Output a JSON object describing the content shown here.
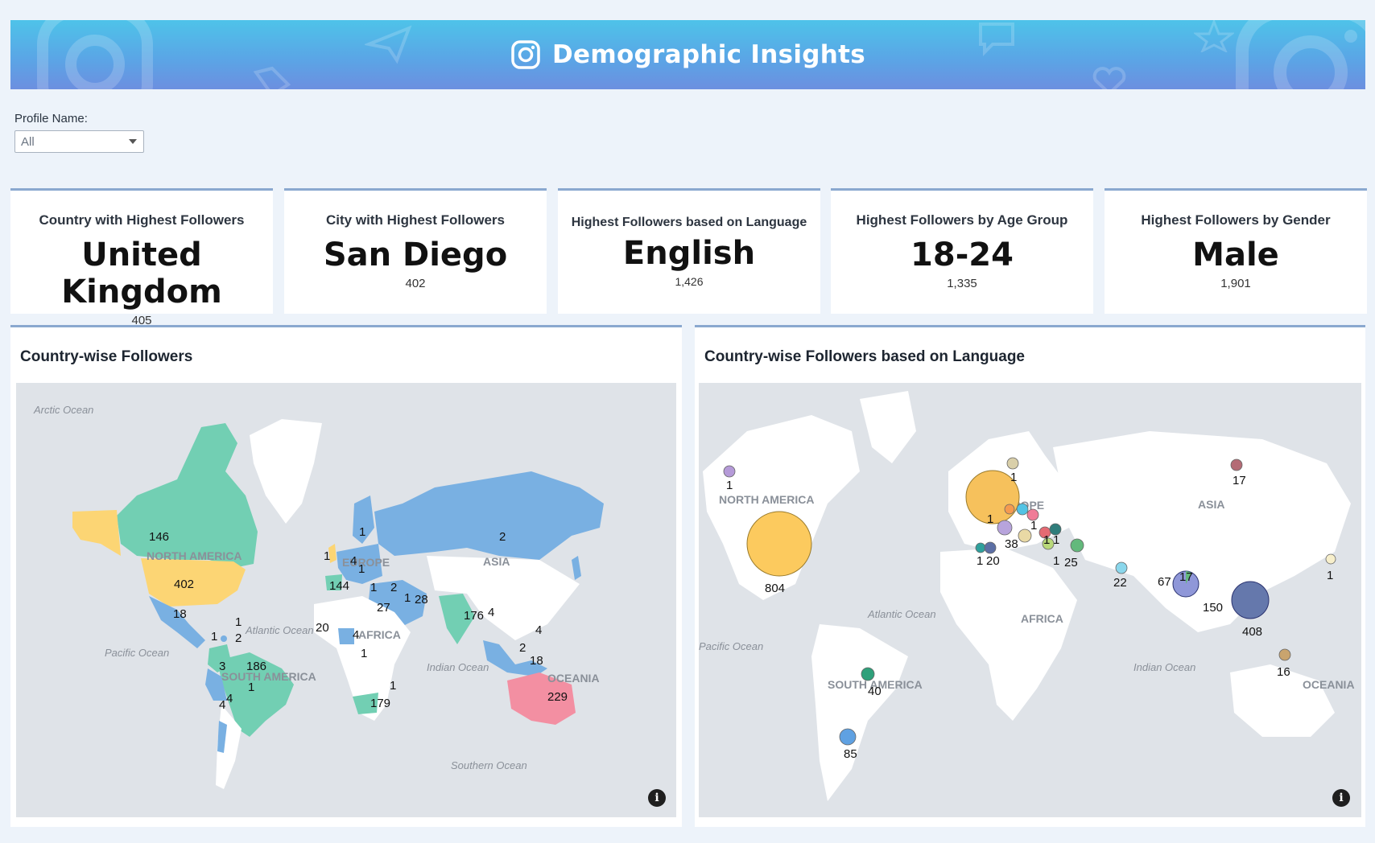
{
  "header": {
    "title": "Demographic Insights",
    "icon": "instagram-icon",
    "colors": {
      "gradient_top": "#4ec3e9",
      "gradient_bottom": "#6c8fe0"
    }
  },
  "filter": {
    "label": "Profile Name:",
    "selected": "All"
  },
  "kpis": [
    {
      "title": "Country with Highest Followers",
      "value": "United Kingdom",
      "count": "405"
    },
    {
      "title": "City with Highest Followers",
      "value": "San Diego",
      "count": "402"
    },
    {
      "title": "Highest Followers based on Language",
      "value": "English",
      "count": "1,426"
    },
    {
      "title": "Highest Followers by Age Group",
      "value": "18-24",
      "count": "1,335"
    },
    {
      "title": "Highest Followers by Gender",
      "value": "Male",
      "count": "1,901"
    }
  ],
  "country_map": {
    "title": "Country-wise Followers",
    "oceans": [
      "Arctic Ocean",
      "Pacific Ocean",
      "Atlantic Ocean",
      "Indian Ocean",
      "Southern Ocean"
    ],
    "continents": [
      "NORTH AMERICA",
      "SOUTH AMERICA",
      "EUROPE",
      "ASIA",
      "AFRICA",
      "OCEANIA"
    ],
    "colors": {
      "green": "#72cfb3",
      "yellow": "#fcd574",
      "blue": "#79b0e2",
      "pink": "#f38fa2",
      "land": "#ffffff",
      "sea": "#dfe3e8"
    },
    "labels": [
      "146",
      "402",
      "18",
      "1",
      "1",
      "2",
      "186",
      "3",
      "1",
      "4",
      "144",
      "1",
      "4",
      "1",
      "1",
      "1",
      "2",
      "27",
      "1",
      "28",
      "2",
      "176",
      "4",
      "4",
      "20",
      "4",
      "1",
      "1",
      "179",
      "4",
      "2",
      "18",
      "229"
    ]
  },
  "language_map": {
    "title": "Country-wise Followers based on Language",
    "oceans": [
      "Atlantic Ocean",
      "Pacific Ocean",
      "Indian Ocean"
    ],
    "continents": [
      "NORTH AMERICA",
      "SOUTH AMERICA",
      "EUROPE",
      "ASIA",
      "AFRICA",
      "OCEANIA"
    ],
    "labels": [
      "1",
      "804",
      "1",
      "1",
      "38",
      "1",
      "1",
      "1",
      "1",
      "20",
      "1",
      "25",
      "17",
      "22",
      "67",
      "17",
      "150",
      "408",
      "1",
      "16",
      "40",
      "85"
    ]
  }
}
